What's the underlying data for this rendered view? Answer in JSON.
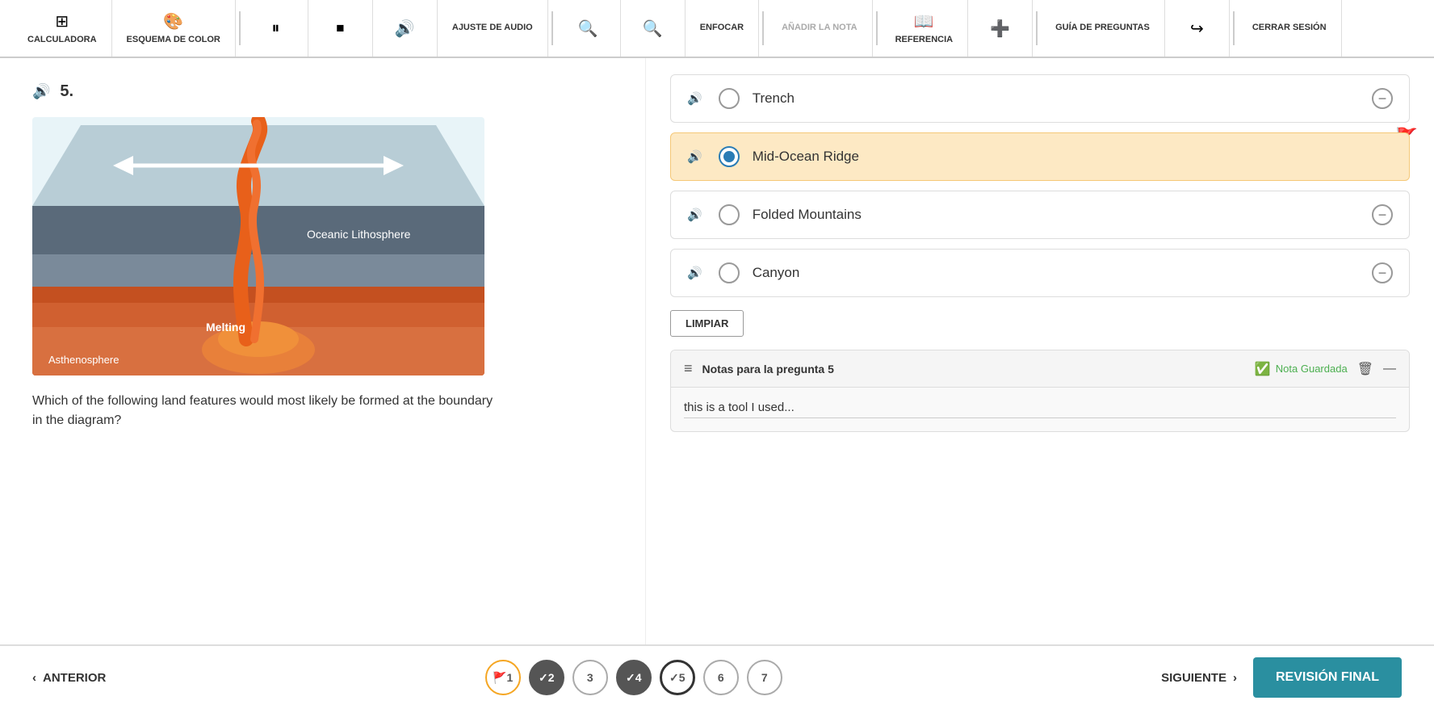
{
  "toolbar": {
    "calculadora_label": "CALCULADORA",
    "esquema_label": "ESQUEMA DE COLOR",
    "ajuste_label": "AJUSTE DE AUDIO",
    "enfocar_label": "ENFOCAR",
    "añadir_label": "AÑADIR LA NOTA",
    "referencia_label": "REFERENCIA",
    "guia_label": "GUÍA DE PREGUNTAS",
    "cerrar_label": "CERRAR SESIÓN"
  },
  "question": {
    "number": "5.",
    "text": "Which of the following land features would most likely be formed at the boundary in the diagram?"
  },
  "answers": [
    {
      "id": "a",
      "text": "Trench",
      "selected": false
    },
    {
      "id": "b",
      "text": "Mid-Ocean Ridge",
      "selected": true
    },
    {
      "id": "c",
      "text": "Folded Mountains",
      "selected": false
    },
    {
      "id": "d",
      "text": "Canyon",
      "selected": false
    }
  ],
  "clear_label": "LIMPIAR",
  "notes": {
    "title": "Notas para la pregunta 5",
    "saved_label": "Nota Guardada",
    "content": "this is a tool I used..."
  },
  "nav": {
    "anterior_label": "ANTERIOR",
    "siguiente_label": "SIGUIENTE",
    "final_review_label": "REVISIÓN FINAL",
    "pages": [
      {
        "num": "1",
        "state": "flagged"
      },
      {
        "num": "2",
        "state": "checked"
      },
      {
        "num": "3",
        "state": "normal"
      },
      {
        "num": "4",
        "state": "checked"
      },
      {
        "num": "5",
        "state": "current"
      },
      {
        "num": "6",
        "state": "normal"
      },
      {
        "num": "7",
        "state": "normal"
      }
    ]
  },
  "diagram": {
    "oceanic_label": "Oceanic Lithosphere",
    "melting_label": "Melting",
    "asthenosphere_label": "Asthenosphere"
  }
}
